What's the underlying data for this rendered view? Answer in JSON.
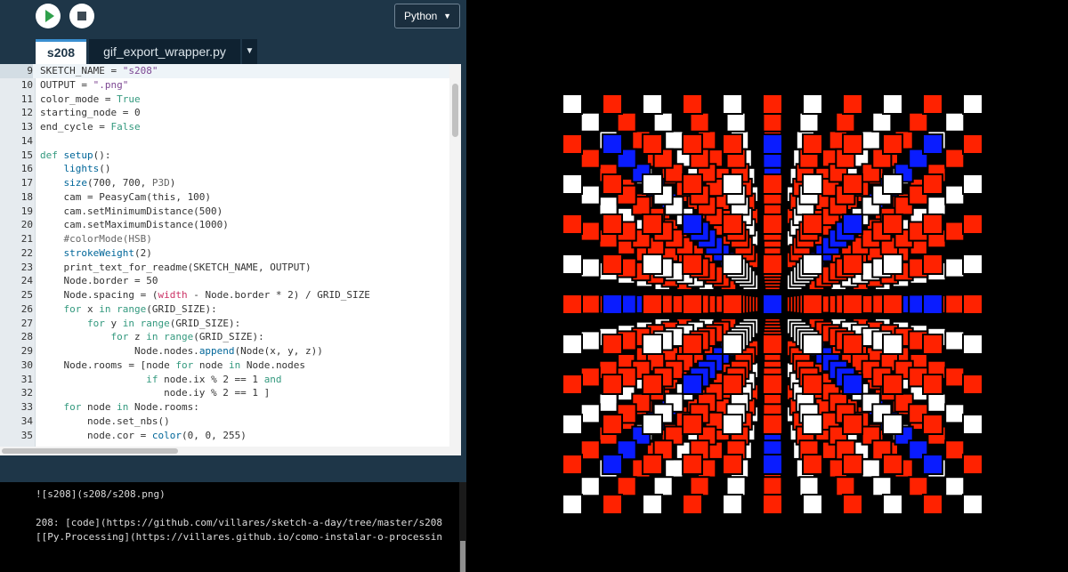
{
  "toolbar": {
    "mode_label": "Python",
    "mode_caret": "▼"
  },
  "tabs": [
    {
      "label": "s208"
    },
    {
      "label": "gif_export_wrapper.py"
    },
    {
      "label": "▼"
    }
  ],
  "editor": {
    "lines": [
      {
        "n": "9",
        "tokens": [
          [
            "",
            "SKETCH_NAME = "
          ],
          [
            "str",
            "\"s208\""
          ]
        ]
      },
      {
        "n": "10",
        "tokens": [
          [
            "",
            "OUTPUT = "
          ],
          [
            "str",
            "\".png\""
          ]
        ]
      },
      {
        "n": "11",
        "tokens": [
          [
            "",
            "color_mode = "
          ],
          [
            "kw",
            "True"
          ]
        ]
      },
      {
        "n": "12",
        "tokens": [
          [
            "",
            "starting_node = 0"
          ]
        ]
      },
      {
        "n": "13",
        "tokens": [
          [
            "",
            "end_cycle = "
          ],
          [
            "kw",
            "False"
          ]
        ]
      },
      {
        "n": "14",
        "tokens": [
          [
            "",
            ""
          ]
        ]
      },
      {
        "n": "15",
        "tokens": [
          [
            "kw",
            "def "
          ],
          [
            "fn",
            "setup"
          ],
          [
            "",
            "():"
          ]
        ]
      },
      {
        "n": "16",
        "tokens": [
          [
            "",
            "    "
          ],
          [
            "fn",
            "lights"
          ],
          [
            "",
            "()"
          ]
        ]
      },
      {
        "n": "17",
        "tokens": [
          [
            "",
            "    "
          ],
          [
            "fn",
            "size"
          ],
          [
            "",
            "(700, 700, "
          ],
          [
            "cm",
            "P3D"
          ],
          [
            "",
            ")"
          ]
        ]
      },
      {
        "n": "18",
        "tokens": [
          [
            "",
            "    cam = PeasyCam(this, 100)"
          ]
        ]
      },
      {
        "n": "19",
        "tokens": [
          [
            "",
            "    cam.setMinimumDistance(500)"
          ]
        ]
      },
      {
        "n": "20",
        "tokens": [
          [
            "",
            "    cam.setMaximumDistance(1000)"
          ]
        ]
      },
      {
        "n": "21",
        "tokens": [
          [
            "cm",
            "    #colorMode(HSB)"
          ]
        ]
      },
      {
        "n": "22",
        "tokens": [
          [
            "",
            "    "
          ],
          [
            "fn",
            "strokeWeight"
          ],
          [
            "",
            "(2)"
          ]
        ]
      },
      {
        "n": "23",
        "tokens": [
          [
            "",
            "    print_text_for_readme(SKETCH_NAME, OUTPUT)"
          ]
        ]
      },
      {
        "n": "24",
        "tokens": [
          [
            "",
            "    Node.border = 50"
          ]
        ]
      },
      {
        "n": "25",
        "tokens": [
          [
            "",
            "    Node.spacing = ("
          ],
          [
            "op",
            "width"
          ],
          [
            "",
            " - Node.border * 2) / GRID_SIZE"
          ]
        ]
      },
      {
        "n": "26",
        "tokens": [
          [
            "",
            "    "
          ],
          [
            "kw",
            "for"
          ],
          [
            "",
            " x "
          ],
          [
            "kw",
            "in"
          ],
          [
            "",
            ""
          ],
          [
            "kw",
            " range"
          ],
          [
            "",
            "(GRID_SIZE):"
          ]
        ]
      },
      {
        "n": "27",
        "tokens": [
          [
            "",
            "        "
          ],
          [
            "kw",
            "for"
          ],
          [
            "",
            " y "
          ],
          [
            "kw",
            "in"
          ],
          [
            "kw",
            " range"
          ],
          [
            "",
            "(GRID_SIZE):"
          ]
        ]
      },
      {
        "n": "28",
        "tokens": [
          [
            "",
            "            "
          ],
          [
            "kw",
            "for"
          ],
          [
            "",
            " z "
          ],
          [
            "kw",
            "in"
          ],
          [
            "kw",
            " range"
          ],
          [
            "",
            "(GRID_SIZE):"
          ]
        ]
      },
      {
        "n": "29",
        "tokens": [
          [
            "",
            "                Node.nodes."
          ],
          [
            "fn",
            "append"
          ],
          [
            "",
            "(Node(x, y, z))"
          ]
        ]
      },
      {
        "n": "30",
        "tokens": [
          [
            "",
            "    Node.rooms = [node "
          ],
          [
            "kw",
            "for"
          ],
          [
            "",
            " node "
          ],
          [
            "kw",
            "in"
          ],
          [
            "",
            " Node.nodes"
          ]
        ]
      },
      {
        "n": "31",
        "tokens": [
          [
            "",
            "                  "
          ],
          [
            "kw",
            "if"
          ],
          [
            "",
            " node.ix % 2 == 1 "
          ],
          [
            "kw",
            "and"
          ]
        ]
      },
      {
        "n": "32",
        "tokens": [
          [
            "",
            "                     node.iy % 2 == 1 ]"
          ]
        ]
      },
      {
        "n": "33",
        "tokens": [
          [
            "",
            "    "
          ],
          [
            "kw",
            "for"
          ],
          [
            "",
            " node "
          ],
          [
            "kw",
            "in"
          ],
          [
            "",
            " Node.rooms:"
          ]
        ]
      },
      {
        "n": "34",
        "tokens": [
          [
            "",
            "        node.set_nbs()"
          ]
        ]
      },
      {
        "n": "35",
        "tokens": [
          [
            "",
            "        node.cor = "
          ],
          [
            "fn",
            "color"
          ],
          [
            "",
            "(0, 0, 255)"
          ]
        ]
      }
    ]
  },
  "console": {
    "lines": [
      "![s208](s208/s208.png)",
      "",
      "208: [code](https://github.com/villares/sketch-a-day/tree/master/s208",
      "[[Py.Processing](https://villares.github.io/como-instalar-o-processin"
    ]
  },
  "sketch": {
    "grid_size": 11,
    "colors": {
      "red": "#ff2200",
      "blue": "#0a1cff",
      "white": "#ffffff",
      "background": "#000000"
    }
  }
}
